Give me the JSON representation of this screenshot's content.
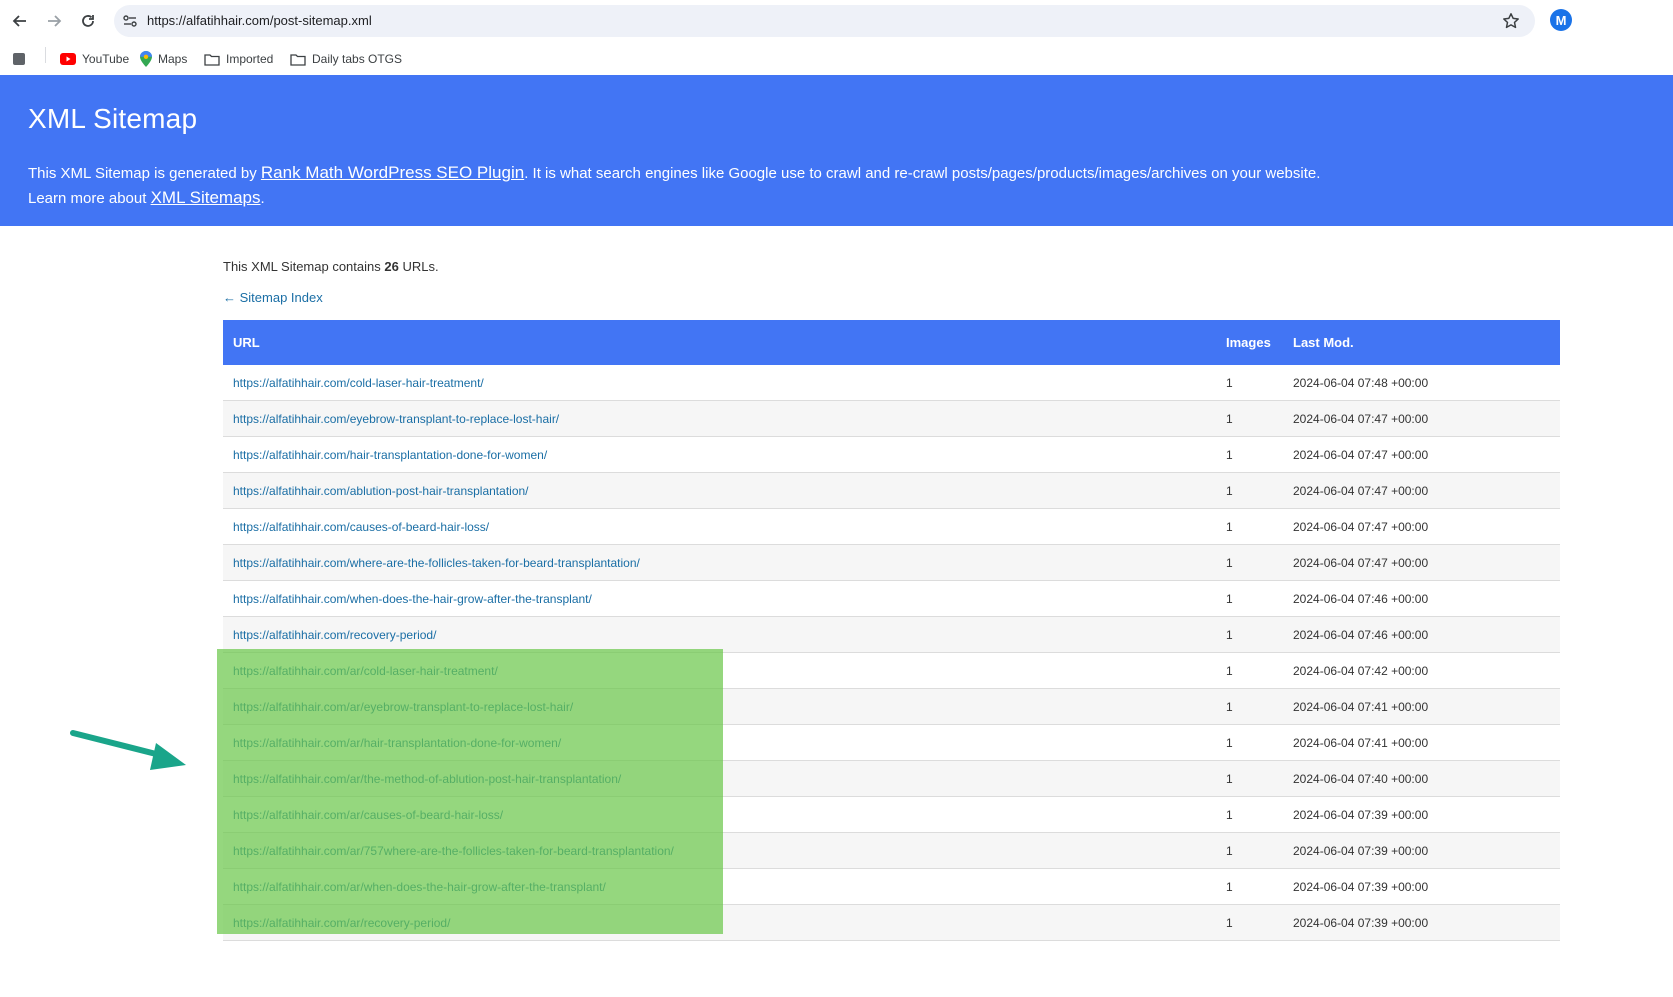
{
  "browser": {
    "url": "https://alfatihhair.com/post-sitemap.xml",
    "extension_icon": "M",
    "bookmarks": [
      {
        "label": "YouTube",
        "icon": "youtube-icon"
      },
      {
        "label": "Maps",
        "icon": "maps-pin-icon"
      },
      {
        "label": "Imported",
        "icon": "folder-icon"
      },
      {
        "label": "Daily tabs OTGS",
        "icon": "folder-icon"
      }
    ]
  },
  "header": {
    "title": "XML Sitemap",
    "line1_before": "This XML Sitemap is generated by ",
    "line1_link": "Rank Math WordPress SEO Plugin",
    "line1_after": ". It is what search engines like Google use to crawl and re-crawl posts/pages/products/images/archives on your website.",
    "line2_before": "Learn more about ",
    "line2_link": "XML Sitemaps",
    "line2_after": "."
  },
  "summary": {
    "before": "This XML Sitemap contains ",
    "count": "26",
    "after": " URLs."
  },
  "back_link": "← Sitemap Index",
  "table": {
    "headers": {
      "url": "URL",
      "images": "Images",
      "last_mod": "Last Mod."
    },
    "rows": [
      {
        "url": "https://alfatihhair.com/cold-laser-hair-treatment/",
        "images": "1",
        "last_mod": "2024-06-04 07:48 +00:00"
      },
      {
        "url": "https://alfatihhair.com/eyebrow-transplant-to-replace-lost-hair/",
        "images": "1",
        "last_mod": "2024-06-04 07:47 +00:00"
      },
      {
        "url": "https://alfatihhair.com/hair-transplantation-done-for-women/",
        "images": "1",
        "last_mod": "2024-06-04 07:47 +00:00"
      },
      {
        "url": "https://alfatihhair.com/ablution-post-hair-transplantation/",
        "images": "1",
        "last_mod": "2024-06-04 07:47 +00:00"
      },
      {
        "url": "https://alfatihhair.com/causes-of-beard-hair-loss/",
        "images": "1",
        "last_mod": "2024-06-04 07:47 +00:00"
      },
      {
        "url": "https://alfatihhair.com/where-are-the-follicles-taken-for-beard-transplantation/",
        "images": "1",
        "last_mod": "2024-06-04 07:47 +00:00"
      },
      {
        "url": "https://alfatihhair.com/when-does-the-hair-grow-after-the-transplant/",
        "images": "1",
        "last_mod": "2024-06-04 07:46 +00:00"
      },
      {
        "url": "https://alfatihhair.com/recovery-period/",
        "images": "1",
        "last_mod": "2024-06-04 07:46 +00:00"
      },
      {
        "url": "https://alfatihhair.com/ar/cold-laser-hair-treatment/",
        "images": "1",
        "last_mod": "2024-06-04 07:42 +00:00"
      },
      {
        "url": "https://alfatihhair.com/ar/eyebrow-transplant-to-replace-lost-hair/",
        "images": "1",
        "last_mod": "2024-06-04 07:41 +00:00"
      },
      {
        "url": "https://alfatihhair.com/ar/hair-transplantation-done-for-women/",
        "images": "1",
        "last_mod": "2024-06-04 07:41 +00:00"
      },
      {
        "url": "https://alfatihhair.com/ar/the-method-of-ablution-post-hair-transplantation/",
        "images": "1",
        "last_mod": "2024-06-04 07:40 +00:00"
      },
      {
        "url": "https://alfatihhair.com/ar/causes-of-beard-hair-loss/",
        "images": "1",
        "last_mod": "2024-06-04 07:39 +00:00"
      },
      {
        "url": "https://alfatihhair.com/ar/757where-are-the-follicles-taken-for-beard-transplantation/",
        "images": "1",
        "last_mod": "2024-06-04 07:39 +00:00"
      },
      {
        "url": "https://alfatihhair.com/ar/when-does-the-hair-grow-after-the-transplant/",
        "images": "1",
        "last_mod": "2024-06-04 07:39 +00:00"
      },
      {
        "url": "https://alfatihhair.com/ar/recovery-period/",
        "images": "1",
        "last_mod": "2024-06-04 07:39 +00:00"
      }
    ]
  },
  "annotations": {
    "highlight_color": "#6cc84c",
    "arrow_color": "#1aa58a"
  },
  "colors": {
    "header_bg": "#4275f4",
    "link": "#1a6ea5"
  }
}
